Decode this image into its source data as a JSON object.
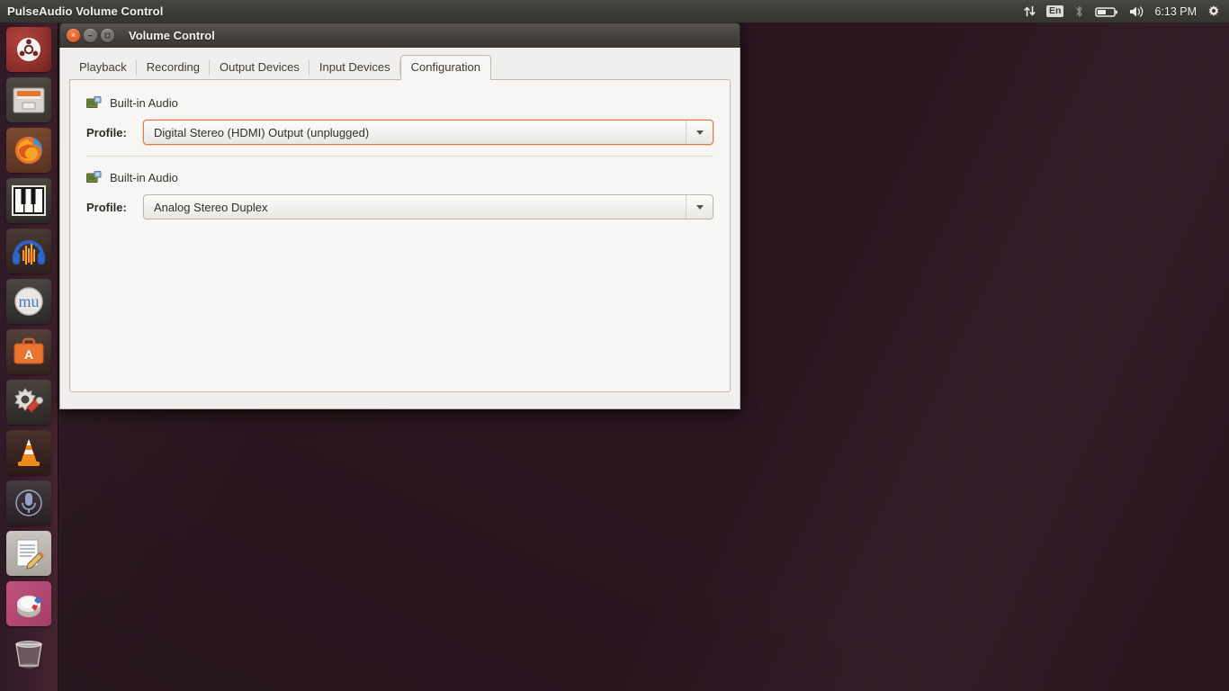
{
  "panel": {
    "app_title": "PulseAudio Volume Control",
    "tray": {
      "network_icon": "network-up-down-arrows-icon",
      "keyboard_layout": "En",
      "bluetooth_icon": "bluetooth-icon",
      "battery_icon": "battery-icon",
      "volume_icon": "volume-speaker-icon",
      "clock": "6:13 PM",
      "session_icon": "gear-session-icon"
    }
  },
  "launcher": {
    "items": [
      {
        "name": "ubuntu-dash-home",
        "icon": "ubuntu-logo-icon",
        "running": false
      },
      {
        "name": "files",
        "icon": "file-manager-icon",
        "running": false
      },
      {
        "name": "firefox",
        "icon": "firefox-icon",
        "running": true
      },
      {
        "name": "piano-keyboard-app",
        "icon": "piano-keys-icon",
        "running": true
      },
      {
        "name": "audacity",
        "icon": "audacity-headphones-icon",
        "running": false
      },
      {
        "name": "musescore",
        "icon": "musescore-icon",
        "running": false
      },
      {
        "name": "ubuntu-software",
        "icon": "software-center-icon",
        "running": false
      },
      {
        "name": "system-settings",
        "icon": "gear-wrench-icon",
        "running": false
      },
      {
        "name": "vlc",
        "icon": "vlc-cone-icon",
        "running": false
      },
      {
        "name": "sound-recorder",
        "icon": "microphone-icon",
        "running": false
      },
      {
        "name": "text-editor",
        "icon": "document-pencil-icon",
        "running": true
      },
      {
        "name": "pulseaudio-volume-control",
        "icon": "volume-control-icon",
        "running": true
      },
      {
        "name": "trash",
        "icon": "trash-bin-icon",
        "running": false
      }
    ]
  },
  "window": {
    "title": "Volume Control",
    "buttons": {
      "close": "×",
      "minimize": "−",
      "maximize": "□"
    },
    "tabs": [
      {
        "label": "Playback",
        "active": false
      },
      {
        "label": "Recording",
        "active": false
      },
      {
        "label": "Output Devices",
        "active": false
      },
      {
        "label": "Input Devices",
        "active": false
      },
      {
        "label": "Configuration",
        "active": true
      }
    ],
    "configuration": {
      "devices": [
        {
          "icon": "audio-card-icon",
          "name": "Built-in Audio",
          "profile_label": "Profile:",
          "profile_value": "Digital Stereo (HDMI) Output (unplugged)",
          "focused": true
        },
        {
          "icon": "audio-card-icon",
          "name": "Built-in Audio",
          "profile_label": "Profile:",
          "profile_value": "Analog Stereo Duplex",
          "focused": false
        }
      ]
    }
  },
  "colors": {
    "panel_bg": "#3c3a36",
    "launcher_bg": "#3b1f2c",
    "close_button": "#df5822",
    "focus_border": "#dd7a3e",
    "window_body": "#f0efed",
    "tab_panel": "#f7f6f5"
  }
}
